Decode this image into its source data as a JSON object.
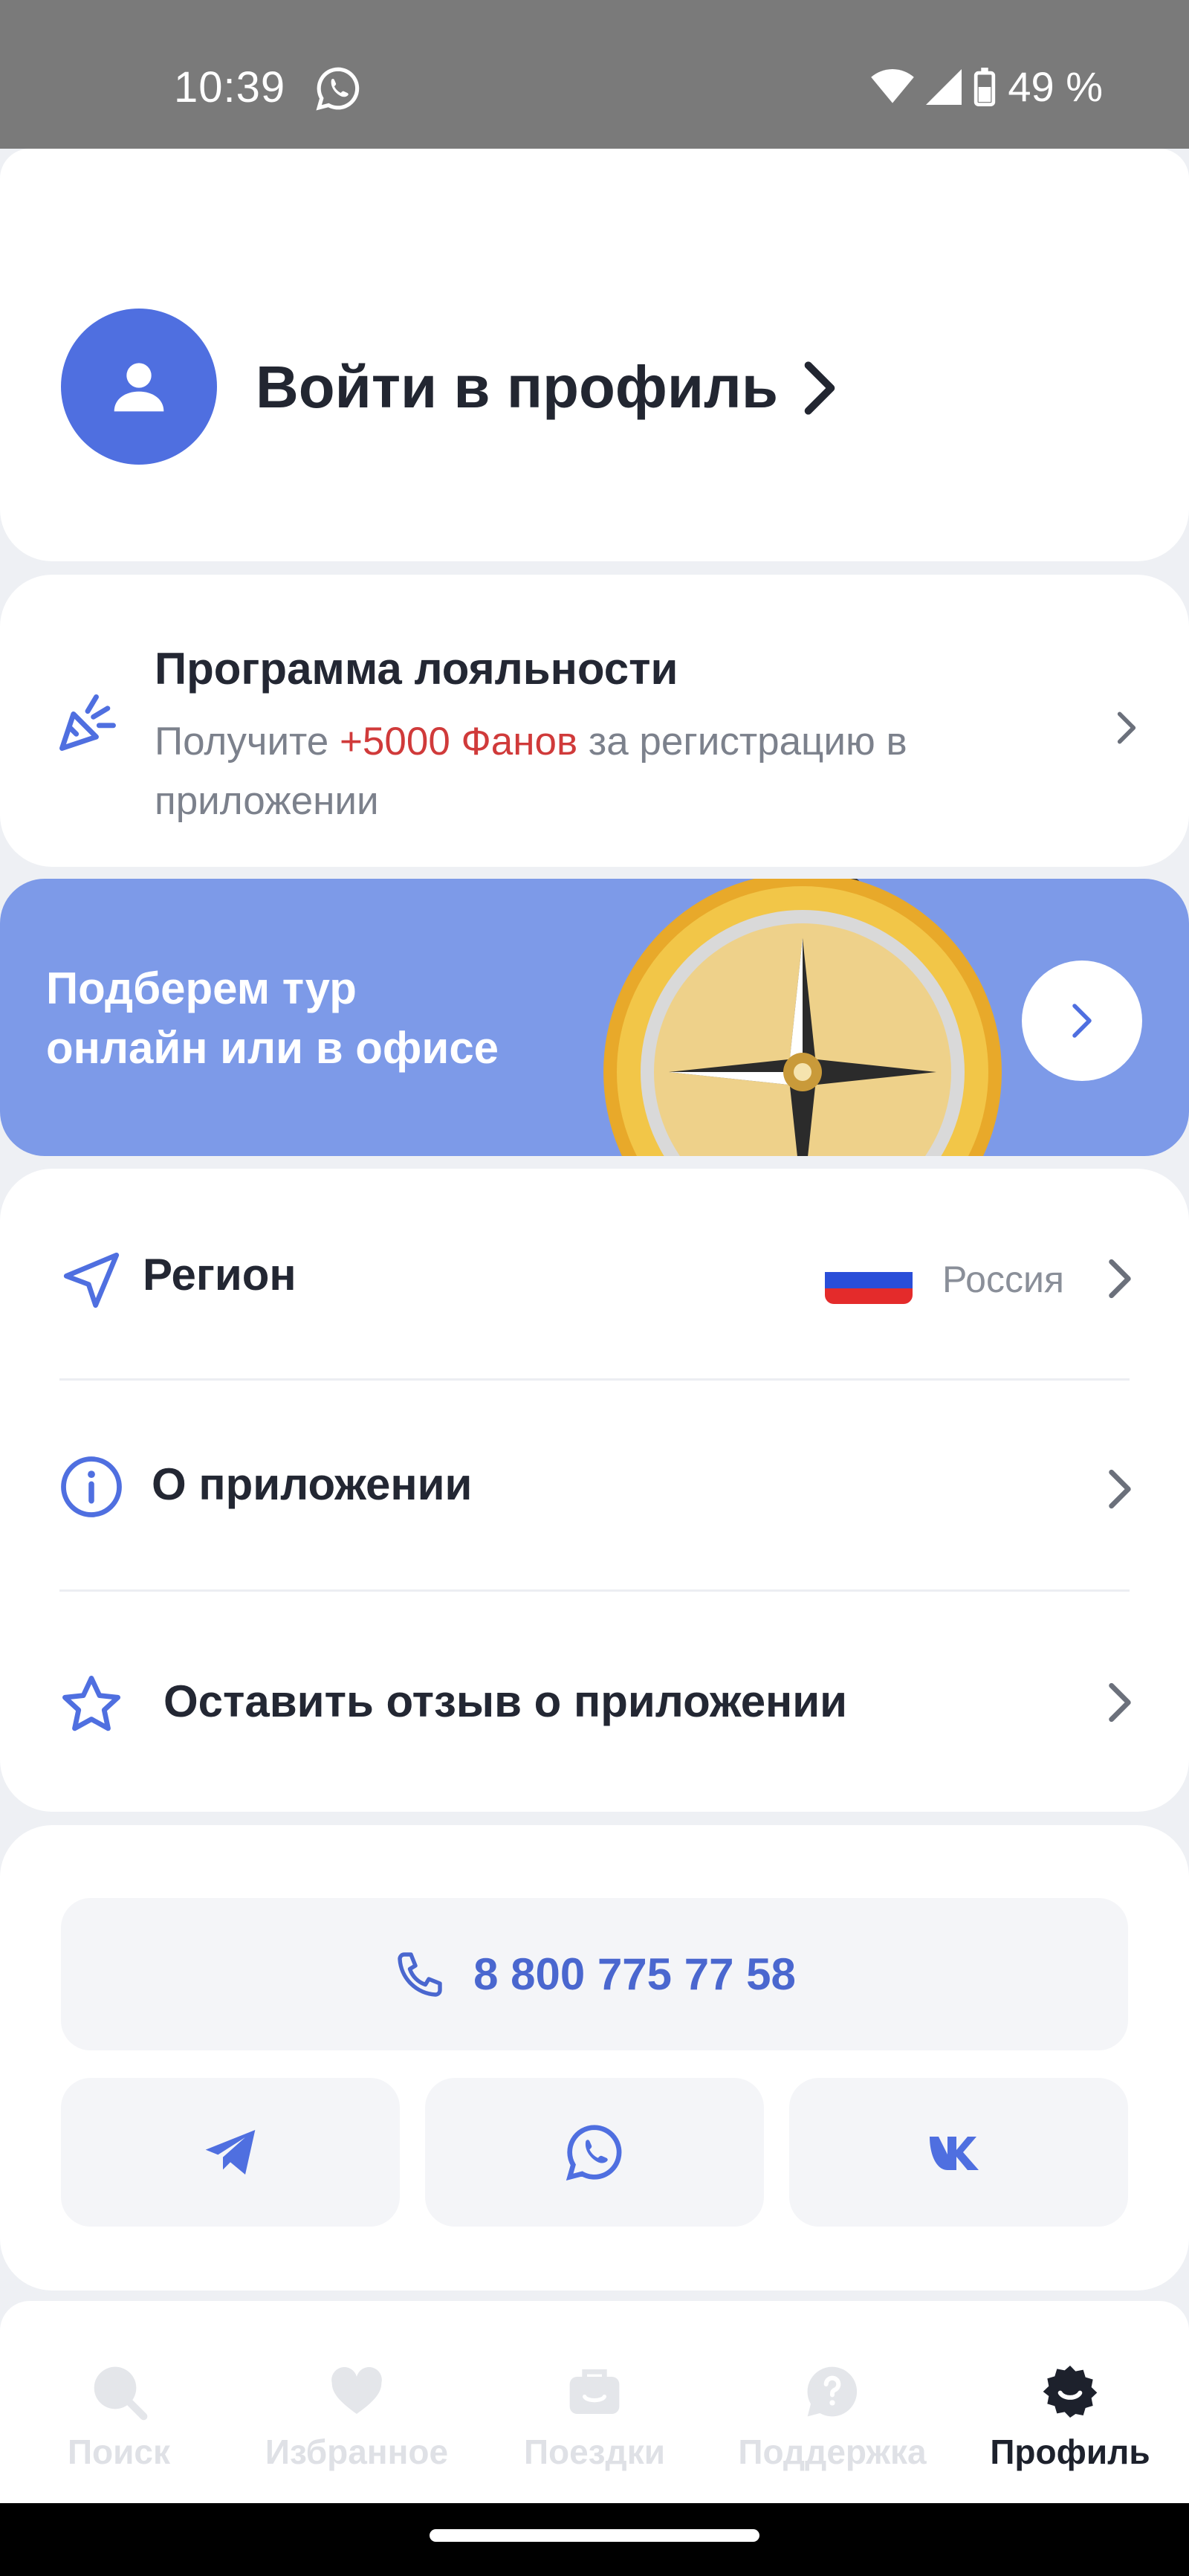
{
  "status_bar": {
    "time": "10:39",
    "battery": "49 %",
    "icons": [
      "whatsapp-icon",
      "wifi-icon",
      "cellular-icon",
      "battery-icon"
    ]
  },
  "profile": {
    "login_label": "Войти в профиль"
  },
  "loyalty": {
    "title": "Программа лояльности",
    "desc_before": "Получите ",
    "desc_accent": "+5000 Фанов",
    "desc_after": " за регистрацию в приложении"
  },
  "banner": {
    "line1": "Подберем тур",
    "line2": "онлайн или в офисе"
  },
  "menu": {
    "region_label": "Регион",
    "region_value": "Россия",
    "about_label": "О приложении",
    "review_label": "Оставить отзыв о приложении"
  },
  "contacts": {
    "phone": "8 800 775 77 58",
    "socials": [
      "telegram-icon",
      "whatsapp-icon",
      "vk-icon"
    ]
  },
  "tabs": [
    {
      "label": "Поиск",
      "icon": "search-icon",
      "active": false
    },
    {
      "label": "Избранное",
      "icon": "heart-icon",
      "active": false
    },
    {
      "label": "Поездки",
      "icon": "suitcase-icon",
      "active": false
    },
    {
      "label": "Поддержка",
      "icon": "question-icon",
      "active": false
    },
    {
      "label": "Профиль",
      "icon": "gear-smile-icon",
      "active": true
    }
  ],
  "colors": {
    "accent": "#4f6fe0",
    "banner": "#7d9ae8",
    "promo": "#d03a3a",
    "inactive_tab": "#dfe1e6"
  }
}
